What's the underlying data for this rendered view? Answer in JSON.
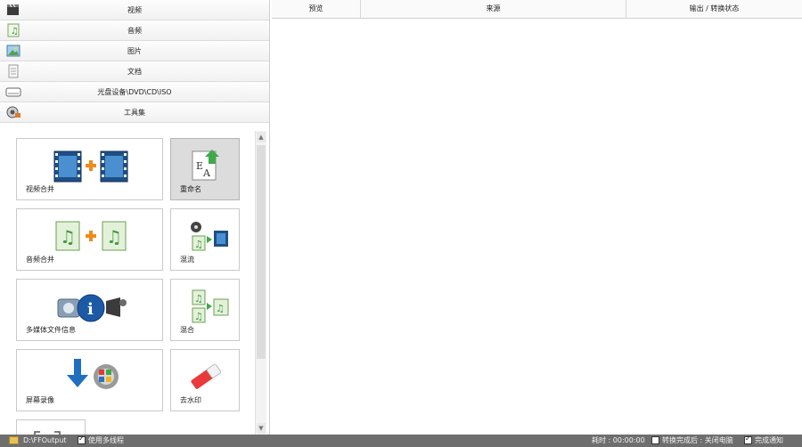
{
  "categories": [
    {
      "label": "视频",
      "icon": "video-clapper-icon"
    },
    {
      "label": "音频",
      "icon": "audio-note-icon"
    },
    {
      "label": "图片",
      "icon": "picture-icon"
    },
    {
      "label": "文档",
      "icon": "document-icon"
    },
    {
      "label": "光盘设备\\DVD\\CD\\ISO",
      "icon": "disc-drive-icon"
    },
    {
      "label": "工具集",
      "icon": "toolbox-icon"
    }
  ],
  "tools": [
    {
      "label": "视频合并",
      "icon": "video-merge-icon"
    },
    {
      "label": "重命名",
      "icon": "rename-icon",
      "selected": true
    },
    {
      "label": "音频合并",
      "icon": "audio-merge-icon"
    },
    {
      "label": "混流",
      "icon": "mux-icon"
    },
    {
      "label": "多媒体文件信息",
      "icon": "media-info-icon"
    },
    {
      "label": "混合",
      "icon": "mix-icon"
    },
    {
      "label": "屏幕录像",
      "icon": "screen-record-icon"
    },
    {
      "label": "去水印",
      "icon": "remove-watermark-icon"
    }
  ],
  "table": {
    "headers": [
      "预览",
      "来源",
      "输出 / 转换状态"
    ],
    "rows": []
  },
  "status": {
    "output_path": "D:\\FFOutput",
    "multithread_label": "使用多线程",
    "time_label": "耗时 : 00:00:00",
    "after_convert_label": "转换完成后 : 关闭电脑",
    "notify_label": "完成通知"
  },
  "colors": {
    "status_bar": "#6e6e6e",
    "selected_tile": "#dcdcdc",
    "film_blue": "#2f6fae",
    "plus_orange": "#f08a1c",
    "audio_green": "#4aa04a"
  }
}
